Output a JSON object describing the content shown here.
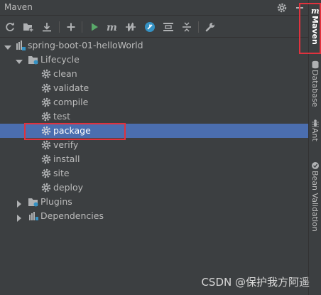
{
  "window": {
    "title": "Maven"
  },
  "tree": {
    "project": "spring-boot-01-helloWorld",
    "lifecycle": "Lifecycle",
    "goals": [
      "clean",
      "validate",
      "compile",
      "test",
      "package",
      "verify",
      "install",
      "site",
      "deploy"
    ],
    "selected_goal": "package",
    "plugins": "Plugins",
    "dependencies": "Dependencies"
  },
  "side_tabs": {
    "maven": "Maven",
    "database": "Database",
    "ant": "Ant",
    "bean_validation": "Bean Validation"
  },
  "watermark": "CSDN @保护我方阿遥",
  "colors": {
    "background": "#3c3f41",
    "selection": "#4b6eaf",
    "run_green": "#59a869",
    "annotation_red": "#e0323e",
    "maven_blue": "#3592c4"
  },
  "icons": [
    "refresh-icon",
    "add-maven-projects-icon",
    "download-icon",
    "plus-icon",
    "run-icon",
    "execute-goal-icon",
    "toggle-offline-icon",
    "skip-tests-icon",
    "show-dependencies-icon",
    "collapse-all-icon",
    "settings-wrench-icon",
    "gear-icon",
    "minimize-icon"
  ]
}
